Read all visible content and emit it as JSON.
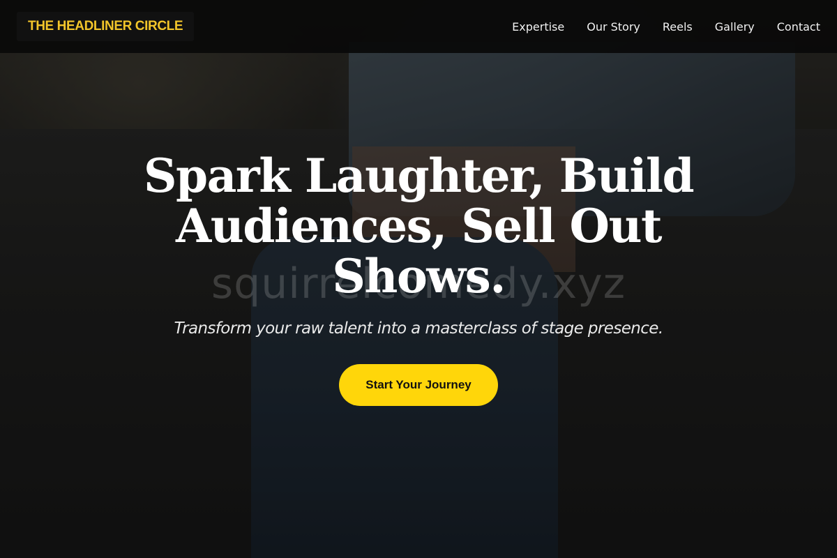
{
  "brand": {
    "name": "THE HEADLINER CIRCLE",
    "accent_color": "#f2c52a"
  },
  "nav": {
    "items": [
      {
        "label": "Expertise"
      },
      {
        "label": "Our Story"
      },
      {
        "label": "Reels"
      },
      {
        "label": "Gallery"
      },
      {
        "label": "Contact"
      }
    ]
  },
  "hero": {
    "headline_line1": "Spark Laughter, Build",
    "headline_line2": "Audiences, Sell Out",
    "headline_line3": "Shows.",
    "watermark": "squirrelcomedy.xyz",
    "subheadline": "Transform your raw talent into a masterclass of stage presence.",
    "cta_label": "Start Your Journey",
    "cta_color": "#ffd60a"
  }
}
